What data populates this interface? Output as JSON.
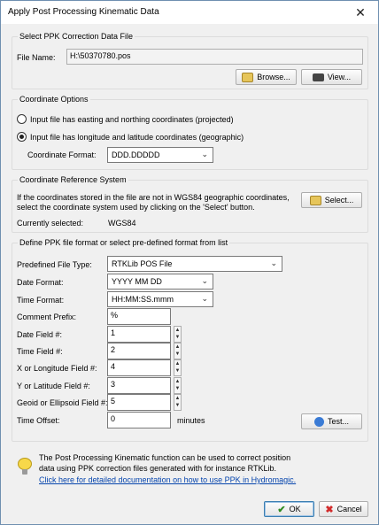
{
  "window": {
    "title": "Apply Post Processing Kinematic Data"
  },
  "ppk_file": {
    "heading": "Select PPK Correction Data File",
    "file_label": "File Name:",
    "file_value": "H:\\50370780.pos",
    "browse_label": "Browse...",
    "view_label": "View..."
  },
  "coord_options": {
    "heading": "Coordinate Options",
    "projected_label": "Input file has easting and northing coordinates (projected)",
    "geographic_label": "Input file has longitude and latitude coordinates (geographic)",
    "selected": "geographic",
    "format_label": "Coordinate Format:",
    "format_value": "DDD.DDDDD"
  },
  "crs": {
    "heading": "Coordinate Reference System",
    "desc_line1": "If the coordinates stored in the file are not in WGS84 geographic coordinates,",
    "desc_line2": "select the coordinate system used by clicking on the 'Select' button.",
    "current_label": "Currently selected:",
    "current_value": "WGS84",
    "select_label": "Select..."
  },
  "format": {
    "heading": "Define PPK file format or select pre-defined format from list",
    "predefined_label": "Predefined File Type:",
    "predefined_value": "RTKLib POS File",
    "date_format_label": "Date Format:",
    "date_format_value": "YYYY MM DD",
    "time_format_label": "Time Format:",
    "time_format_value": "HH:MM:SS.mmm",
    "comment_label": "Comment Prefix:",
    "comment_value": "%",
    "date_field_label": "Date Field #:",
    "date_field_value": "1",
    "time_field_label": "Time Field #:",
    "time_field_value": "2",
    "x_field_label": "X or Longitude Field #:",
    "x_field_value": "4",
    "y_field_label": "Y or Latitude Field #:",
    "y_field_value": "3",
    "geoid_field_label": "Geoid or Ellipsoid Field #:",
    "geoid_field_value": "5",
    "offset_label": "Time Offset:",
    "offset_value": "0",
    "offset_unit": "minutes",
    "test_label": "Test..."
  },
  "hint": {
    "line1": "The Post Processing Kinematic function can be used to correct position",
    "line2": "data using PPK correction files generated with for instance RTKLib.",
    "link": "Click here for detailed documentation on how to use PPK in Hydromagic."
  },
  "footer": {
    "ok_label": "OK",
    "cancel_label": "Cancel"
  },
  "colors": {
    "ok_check": "#2e8b22",
    "cancel_x": "#d22b2b",
    "link": "#0645ad"
  }
}
